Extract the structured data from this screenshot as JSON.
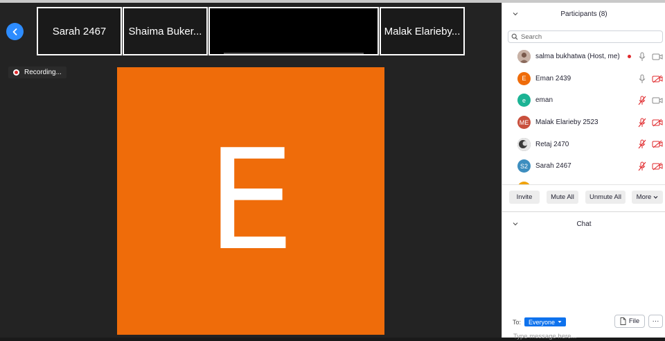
{
  "meeting": {
    "recording_label": "Recording...",
    "main_tile": {
      "letter": "E",
      "color": "#ef6c0a"
    }
  },
  "thumbnails": [
    {
      "name": "Sarah 2467"
    },
    {
      "name": "Shaima Buker..."
    },
    {
      "name": ""
    },
    {
      "name": "Malak Elarieby..."
    }
  ],
  "participants_panel": {
    "title": "Participants (8)",
    "search_placeholder": "Search",
    "participants": [
      {
        "name": "salma bukhatwa (Host, me)",
        "initials": "",
        "avatar_color": "#a98f86",
        "is_host": true,
        "mic": "on",
        "video": "off-outline"
      },
      {
        "name": "Eman 2439",
        "initials": "E",
        "avatar_color": "#ef6c0a",
        "mic": "on",
        "video": "muted"
      },
      {
        "name": "eman",
        "initials": "e",
        "avatar_color": "#1bb394",
        "mic": "muted",
        "video": "on"
      },
      {
        "name": "Malak Elarieby 2523",
        "initials": "ME",
        "avatar_color": "#c9503d",
        "mic": "muted",
        "video": "muted"
      },
      {
        "name": "Retaj 2470",
        "initials": "",
        "avatar_color": "#4a4a4a",
        "mic": "muted",
        "video": "muted"
      },
      {
        "name": "Sarah 2467",
        "initials": "S2",
        "avatar_color": "#3d8ebf",
        "mic": "muted",
        "video": "muted"
      }
    ],
    "buttons": {
      "invite": "Invite",
      "mute_all": "Mute All",
      "unmute_all": "Unmute All",
      "more": "More"
    }
  },
  "chat": {
    "title": "Chat",
    "to_label": "To:",
    "recipient": "Everyone",
    "file_label": "File",
    "more_label": "···",
    "input_placeholder": "Type message here..."
  },
  "colors": {
    "accent": "#0e72ed",
    "back_button": "#2d8cff",
    "muted_red": "#e0292c"
  }
}
